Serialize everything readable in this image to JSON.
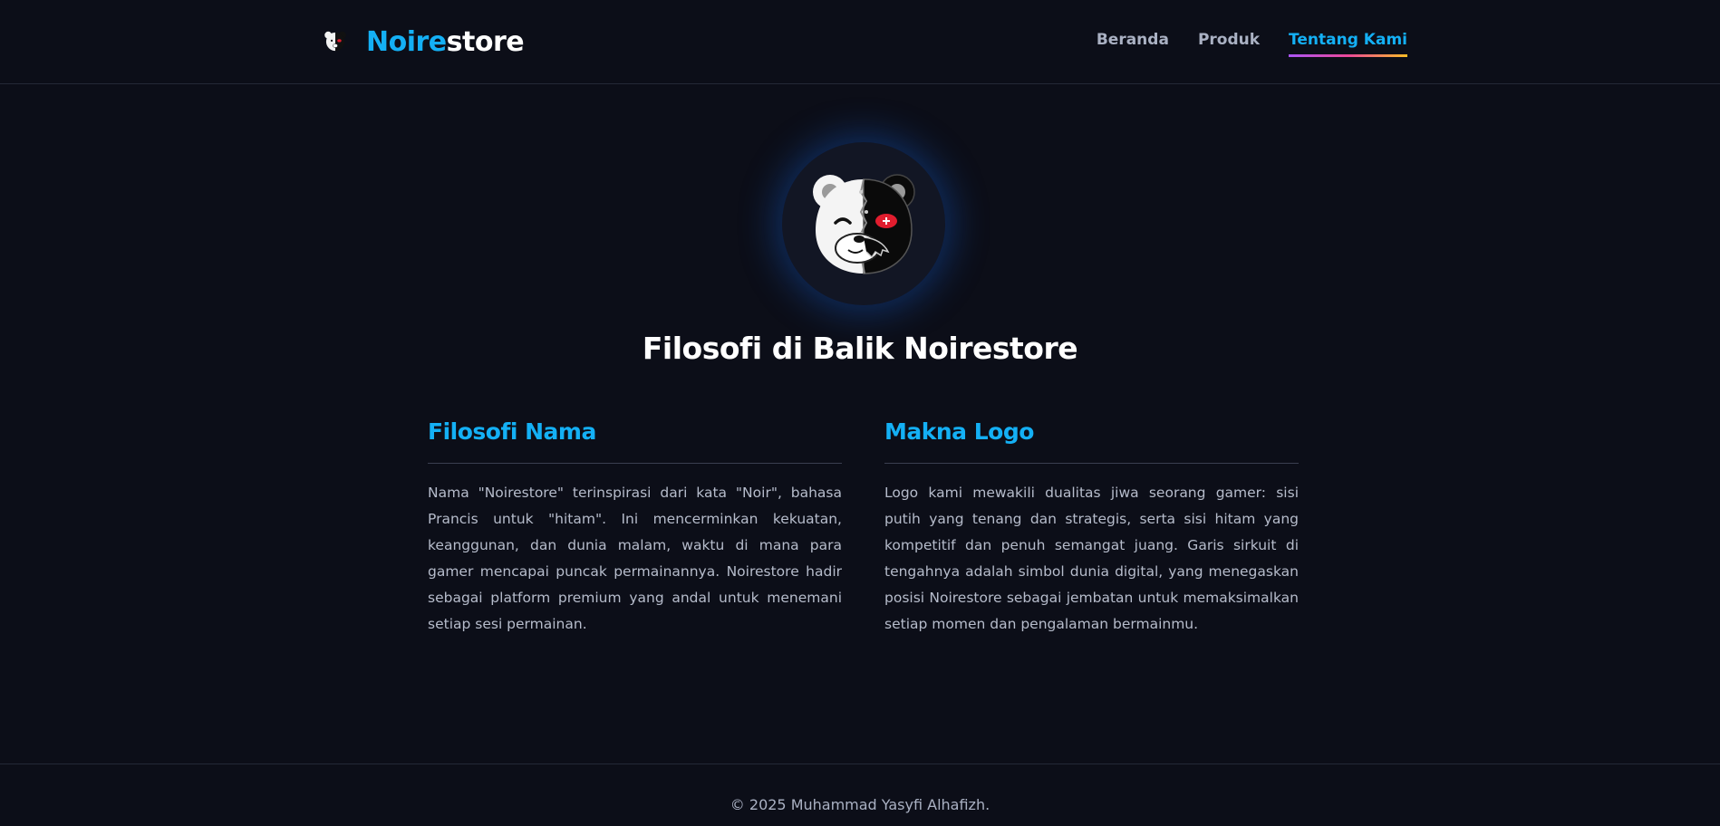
{
  "brand": {
    "name_part1": "Noire",
    "name_part2": "store",
    "logo_icon": "monokuma-bear-icon"
  },
  "nav": {
    "items": [
      {
        "label": "Beranda",
        "active": false
      },
      {
        "label": "Produk",
        "active": false
      },
      {
        "label": "Tentang Kami",
        "active": true
      }
    ]
  },
  "hero": {
    "logo_icon": "monokuma-bear-icon",
    "title": "Filosofi di Balik Noirestore"
  },
  "sections": [
    {
      "title": "Filosofi Nama",
      "body": "Nama \"Noirestore\" terinspirasi dari kata \"Noir\", bahasa Prancis untuk \"hitam\". Ini mencerminkan kekuatan, keanggunan, dan dunia malam, waktu di mana para gamer mencapai puncak permainannya. Noirestore hadir sebagai platform premium yang andal untuk menemani setiap sesi permainan."
    },
    {
      "title": "Makna Logo",
      "body": "Logo kami mewakili dualitas jiwa seorang gamer: sisi putih yang tenang dan strategis, serta sisi hitam yang kompetitif dan penuh semangat juang. Garis sirkuit di tengahnya adalah simbol dunia digital, yang menegaskan posisi Noirestore sebagai jembatan untuk memaksimalkan setiap momen dan pengalaman bermainmu."
    }
  ],
  "footer": {
    "text": "© 2025 Muhammad Yasyfi Alhafizh."
  },
  "colors": {
    "background": "#0c0e18",
    "accent": "#14b0f5",
    "nav_text": "#aab1c3",
    "body_text": "#b6bccb"
  }
}
